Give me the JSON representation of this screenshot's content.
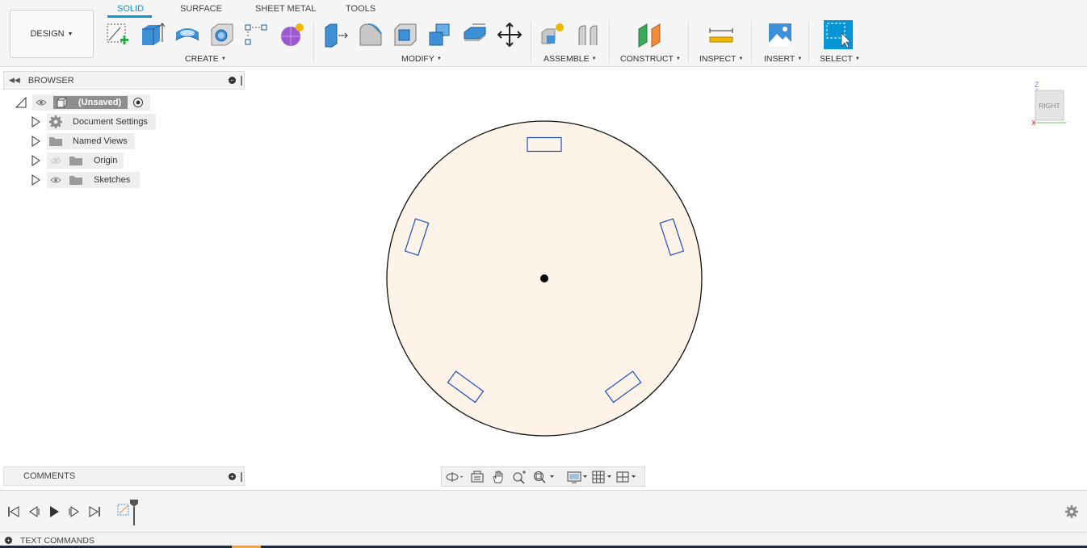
{
  "toolbar": {
    "workspace_button": "DESIGN",
    "tabs": [
      "SOLID",
      "SURFACE",
      "SHEET METAL",
      "TOOLS"
    ],
    "groups": {
      "create": "CREATE",
      "modify": "MODIFY",
      "assemble": "ASSEMBLE",
      "construct": "CONSTRUCT",
      "inspect": "INSPECT",
      "insert": "INSERT",
      "select": "SELECT"
    },
    "accent_color": "#0696d7"
  },
  "browser": {
    "title": "BROWSER",
    "root": "(Unsaved)",
    "items": [
      {
        "label": "Document Settings",
        "icon": "gear-icon"
      },
      {
        "label": "Named Views",
        "icon": "folder-icon"
      },
      {
        "label": "Origin",
        "icon": "folder-icon",
        "visibility": "hidden"
      },
      {
        "label": "Sketches",
        "icon": "folder-icon",
        "visibility": "visible"
      }
    ]
  },
  "comments": {
    "title": "COMMENTS"
  },
  "viewcube": {
    "face": "RIGHT",
    "axis_z": "Z"
  },
  "textcommands": {
    "label": "TEXT COMMANDS"
  },
  "canvas": {
    "disc_fill": "#fdf3e8",
    "slot_color": "#1a4fc4",
    "slot_count": 5
  }
}
